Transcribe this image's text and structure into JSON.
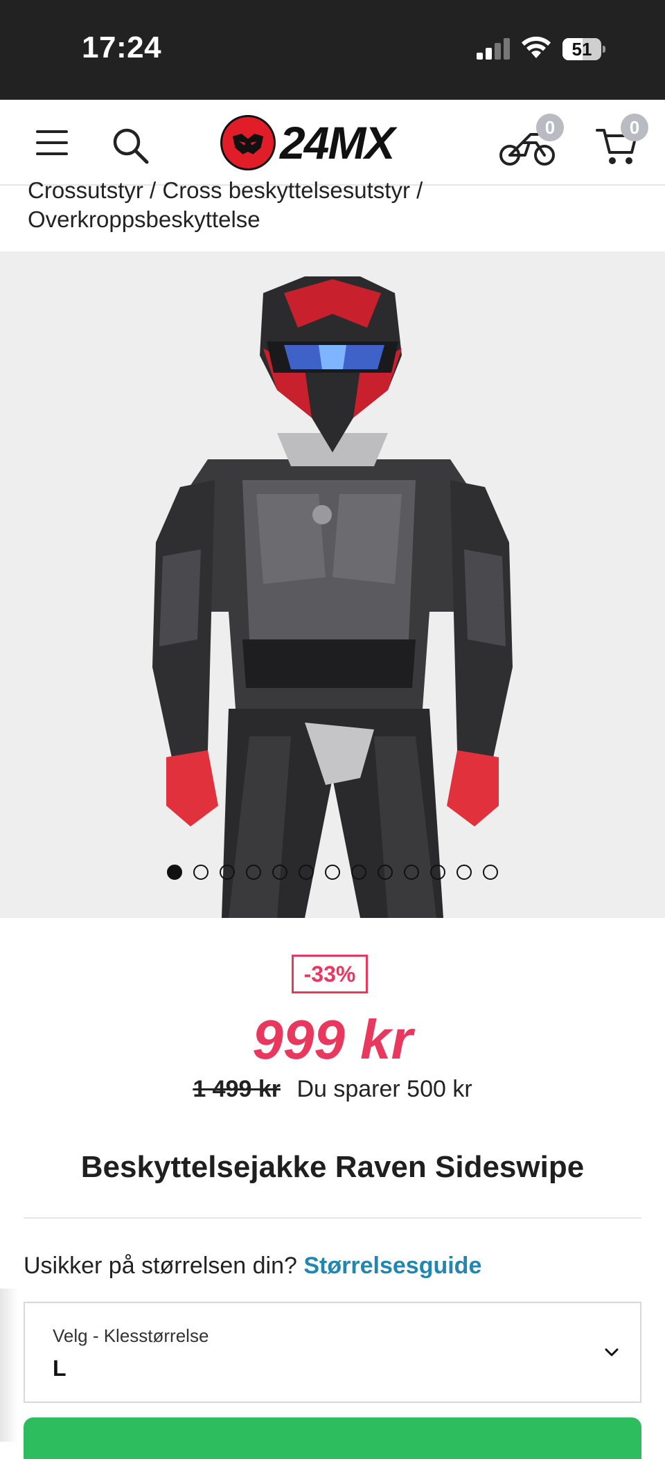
{
  "status_bar": {
    "time": "17:24",
    "battery": "51",
    "battery_level": 0.51
  },
  "header": {
    "logo_text": "24MX",
    "bike_count": "0",
    "cart_count": "0",
    "icons": [
      "menu-icon",
      "search-icon",
      "motorbike-icon",
      "cart-icon"
    ]
  },
  "breadcrumb": {
    "line1": "Crossutstyr / Cross beskyttelsesutstyr /",
    "line2": "Overkroppsbeskyttelse"
  },
  "gallery": {
    "image_count": 13,
    "active_index": 0
  },
  "product": {
    "discount": "-33%",
    "price": "999 kr",
    "old_price": "1 499 kr",
    "savings": "Du sparer 500 kr",
    "title": "Beskyttelsejakke Raven Sideswipe"
  },
  "size": {
    "question": "Usikker på størrelsen din?",
    "guide_link": "Størrelsesguide",
    "select_label": "Velg - Klesstørrelse",
    "select_value": "L"
  },
  "colors": {
    "accent_pink": "#e8385e",
    "link_blue": "#1f87b0",
    "cta_green": "#2ebd5e",
    "logo_red": "#e11d2a"
  }
}
